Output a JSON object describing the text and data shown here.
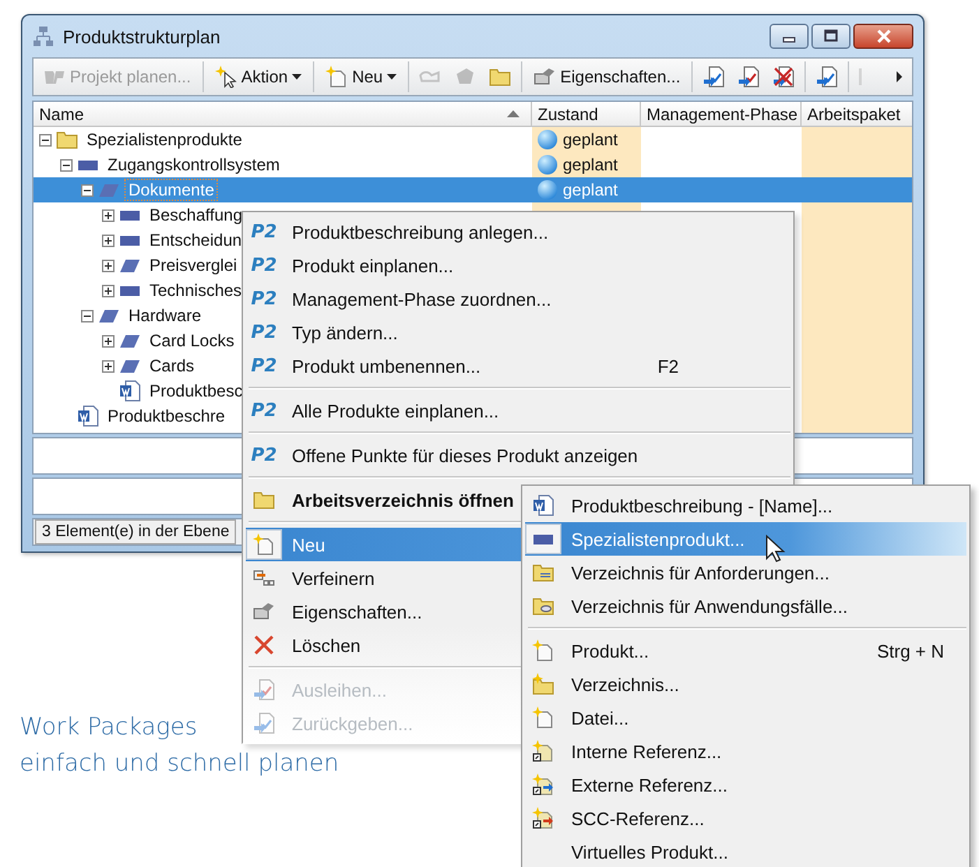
{
  "window": {
    "title": "Produktstrukturplan"
  },
  "toolbar": [
    {
      "kind": "button",
      "label": "Projekt planen...",
      "disabled": true
    },
    {
      "kind": "separator"
    },
    {
      "kind": "dropdown",
      "label": "Aktion",
      "disabled": false
    },
    {
      "kind": "separator"
    },
    {
      "kind": "dropdown",
      "label": "Neu",
      "disabled": false
    },
    {
      "kind": "separator"
    },
    {
      "kind": "icon",
      "disabled": true
    },
    {
      "kind": "icon",
      "disabled": true
    },
    {
      "kind": "icon",
      "disabled": false
    },
    {
      "kind": "separator"
    },
    {
      "kind": "button",
      "label": "Eigenschaften...",
      "disabled": false
    },
    {
      "kind": "separator"
    },
    {
      "kind": "icon",
      "disabled": false
    },
    {
      "kind": "icon",
      "disabled": false
    },
    {
      "kind": "icon",
      "disabled": false
    },
    {
      "kind": "separator"
    },
    {
      "kind": "icon",
      "disabled": false
    },
    {
      "kind": "separator"
    },
    {
      "kind": "icon",
      "disabled": true
    },
    {
      "kind": "overflow",
      "disabled": false
    }
  ],
  "tree": {
    "columns": [
      "Name",
      "Zustand",
      "Management-Phase",
      "Arbeitspaket"
    ],
    "nodes": [
      {
        "label": "Spezialistenprodukte",
        "kind": "folder",
        "expanded": true,
        "selected": false,
        "state": "geplant",
        "children": [
          {
            "label": "Zugangskontrollsystem",
            "kind": "product",
            "expanded": true,
            "selected": false,
            "state": "geplant",
            "children": [
              {
                "label": "Dokumente",
                "kind": "package",
                "expanded": true,
                "selected": true,
                "state": "geplant",
                "children": [
                  {
                    "label": "Beschaffung",
                    "kind": "product",
                    "expanded": false,
                    "selected": false
                  },
                  {
                    "label": "Entscheidun",
                    "kind": "product",
                    "expanded": false,
                    "selected": false
                  },
                  {
                    "label": "Preisverglei",
                    "kind": "package",
                    "expanded": false,
                    "selected": false
                  },
                  {
                    "label": "Technisches",
                    "kind": "product",
                    "expanded": false,
                    "selected": false
                  }
                ]
              },
              {
                "label": "Hardware",
                "kind": "package",
                "expanded": true,
                "selected": false,
                "children": [
                  {
                    "label": "Card Locks",
                    "kind": "package",
                    "expanded": false,
                    "selected": false
                  },
                  {
                    "label": "Cards",
                    "kind": "package",
                    "expanded": false,
                    "selected": false
                  },
                  {
                    "label": "Produktbesc",
                    "kind": "document",
                    "selected": false
                  }
                ]
              }
            ]
          },
          {
            "label": "Produktbeschre",
            "kind": "document",
            "selected": false
          }
        ]
      }
    ]
  },
  "status_bar": {
    "text": "3 Element(e) in der Ebene"
  },
  "context_menu": [
    {
      "kind": "item",
      "badge": "P2",
      "label": "Produktbeschreibung anlegen...",
      "selected": false,
      "disabled": false
    },
    {
      "kind": "item",
      "badge": "P2",
      "label": "Produkt einplanen...",
      "selected": false,
      "disabled": false
    },
    {
      "kind": "item",
      "badge": "P2",
      "label": "Management-Phase zuordnen...",
      "selected": false,
      "disabled": false
    },
    {
      "kind": "item",
      "badge": "P2",
      "label": "Typ ändern...",
      "selected": false,
      "disabled": false
    },
    {
      "kind": "item",
      "badge": "P2",
      "label": "Produkt umbenennen...",
      "shortcut": "F2",
      "selected": false,
      "disabled": false
    },
    {
      "kind": "separator"
    },
    {
      "kind": "item",
      "badge": "P2",
      "label": "Alle Produkte einplanen...",
      "selected": false,
      "disabled": false
    },
    {
      "kind": "separator"
    },
    {
      "kind": "item",
      "badge": "P2",
      "label": "Offene Punkte für dieses Produkt anzeigen",
      "selected": false,
      "disabled": false
    },
    {
      "kind": "separator"
    },
    {
      "kind": "item",
      "label": "Arbeitsverzeichnis öffnen",
      "bold": true,
      "selected": false,
      "disabled": false
    },
    {
      "kind": "separator"
    },
    {
      "kind": "item",
      "label": "Neu",
      "selected": true,
      "disabled": false
    },
    {
      "kind": "item",
      "label": "Verfeinern",
      "selected": false,
      "disabled": false
    },
    {
      "kind": "item",
      "label": "Eigenschaften...",
      "selected": false,
      "disabled": false
    },
    {
      "kind": "item",
      "label": "Löschen",
      "selected": false,
      "disabled": false
    },
    {
      "kind": "separator"
    },
    {
      "kind": "item",
      "label": "Ausleihen...",
      "selected": false,
      "disabled": true
    },
    {
      "kind": "item",
      "label": "Zurückgeben...",
      "selected": false,
      "disabled": true
    }
  ],
  "submenu": [
    {
      "kind": "item",
      "label": "Produktbeschreibung - [Name]...",
      "selected": false
    },
    {
      "kind": "item",
      "label": "Spezialistenprodukt...",
      "selected": true
    },
    {
      "kind": "item",
      "label": "Verzeichnis für Anforderungen...",
      "selected": false
    },
    {
      "kind": "item",
      "label": "Verzeichnis für Anwendungsfälle...",
      "selected": false
    },
    {
      "kind": "separator"
    },
    {
      "kind": "item",
      "label": "Produkt...",
      "shortcut": "Strg + N",
      "selected": false
    },
    {
      "kind": "item",
      "label": "Verzeichnis...",
      "selected": false
    },
    {
      "kind": "item",
      "label": "Datei...",
      "selected": false
    },
    {
      "kind": "item",
      "label": "Interne Referenz...",
      "selected": false
    },
    {
      "kind": "item",
      "label": "Externe Referenz...",
      "selected": false
    },
    {
      "kind": "item",
      "label": "SCC-Referenz...",
      "selected": false
    },
    {
      "kind": "item",
      "label": "Virtuelles Produkt...",
      "selected": false
    }
  ],
  "caption": [
    "Work Packages",
    "einfach und schnell planen"
  ]
}
